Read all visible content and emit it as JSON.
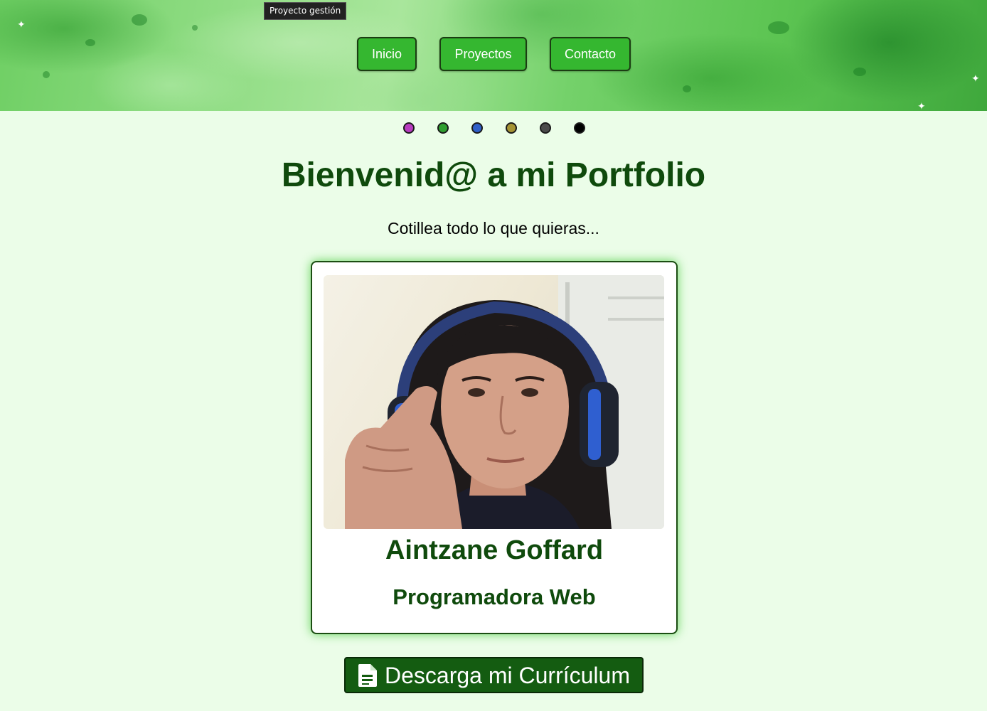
{
  "tooltip": "Proyecto gestión",
  "nav": {
    "items": [
      {
        "label": "Inicio"
      },
      {
        "label": "Proyectos"
      },
      {
        "label": "Contacto"
      }
    ]
  },
  "theme_dots": [
    {
      "color": "#b83cbf"
    },
    {
      "color": "#2f9e2f"
    },
    {
      "color": "#2f5fc8"
    },
    {
      "color": "#a59334"
    },
    {
      "color": "#4b4b4b"
    },
    {
      "color": "#000000"
    }
  ],
  "hero": {
    "title": "Bienvenid@ a mi Portfolio",
    "subtitle": "Cotillea todo lo que quieras..."
  },
  "profile": {
    "name": "Aintzane Goffard",
    "role": "Programadora Web"
  },
  "cv_button": {
    "label": "Descarga mi Currículum",
    "icon": "document-icon"
  },
  "colors": {
    "background": "#ebfde8",
    "nav_button": "#35b730",
    "heading": "#0f4a0c",
    "cv_button": "#145c11"
  }
}
